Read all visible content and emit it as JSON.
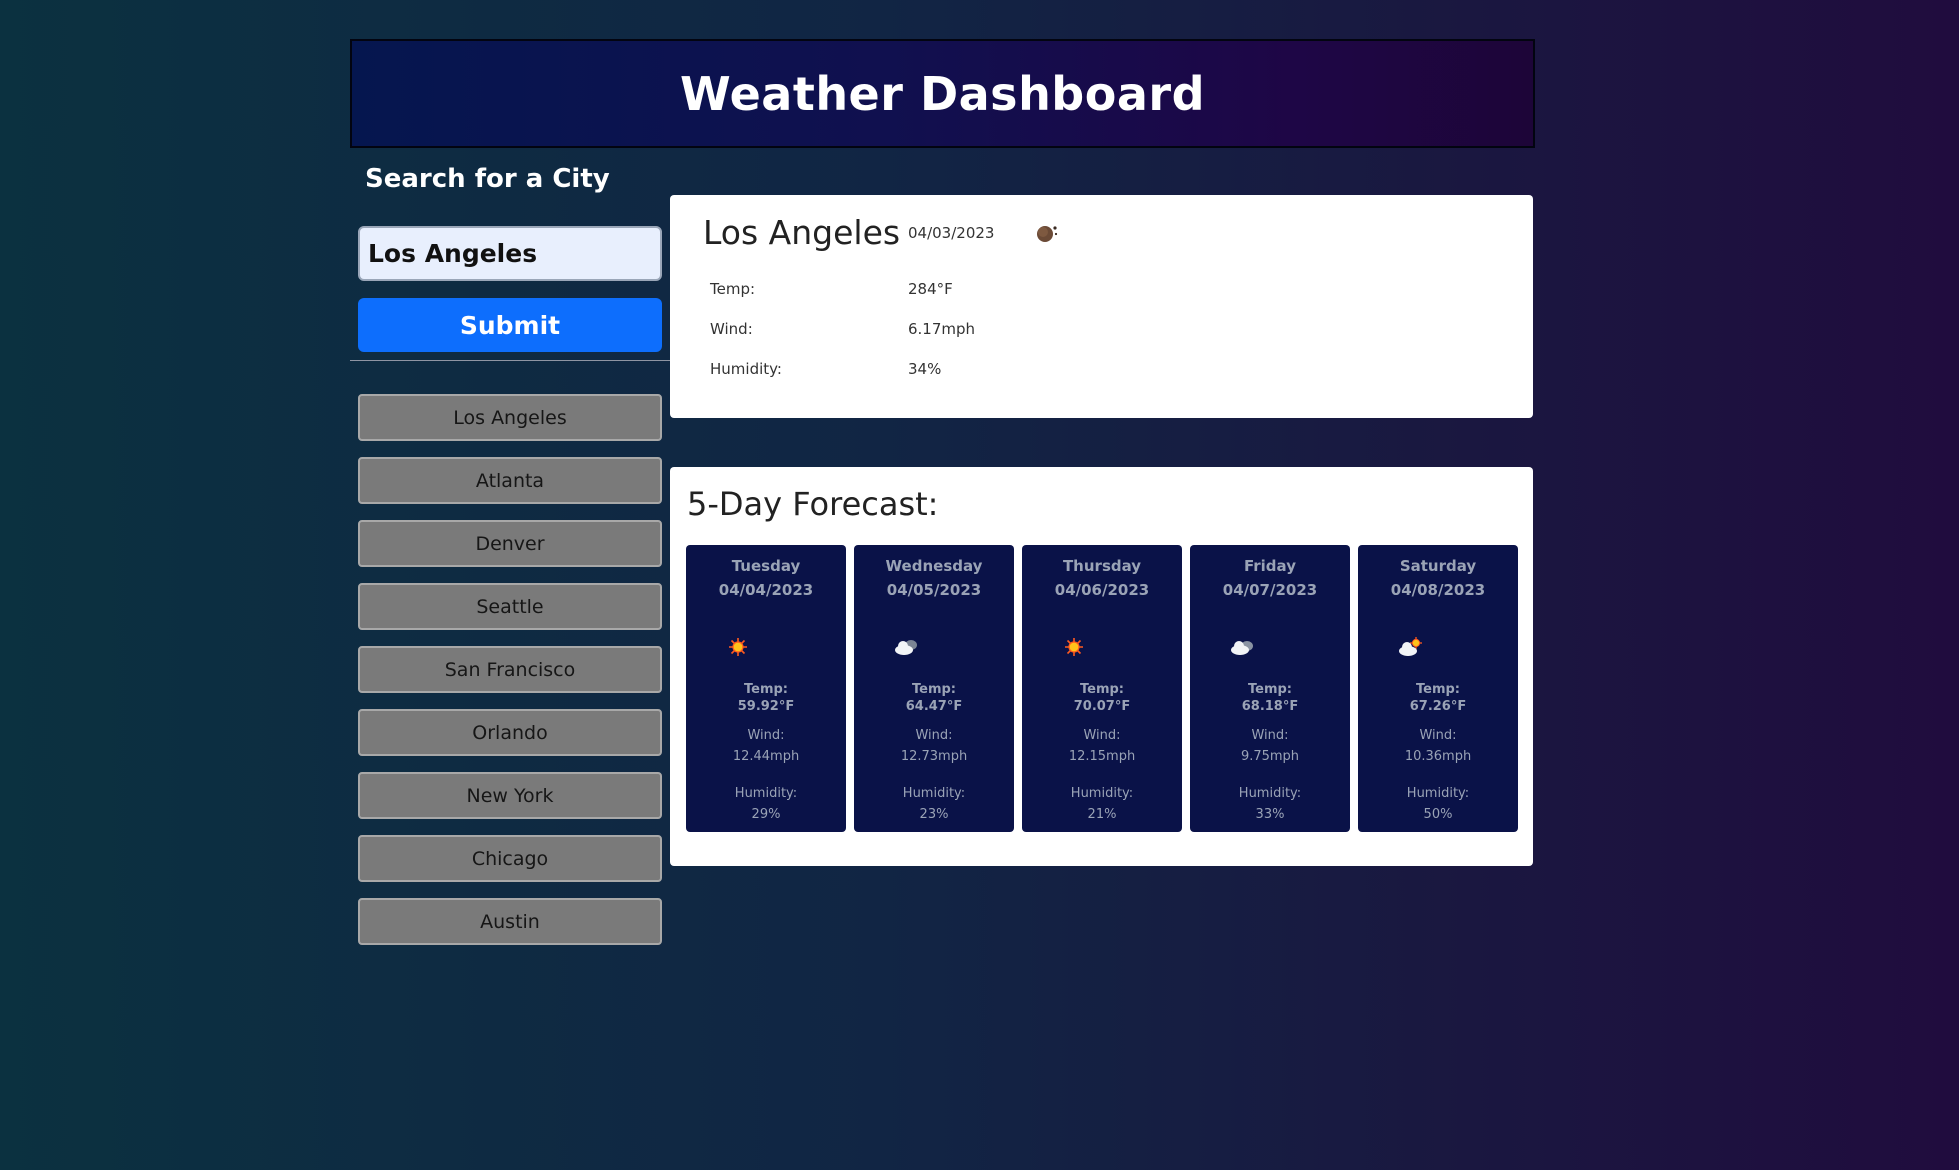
{
  "header": {
    "title": "Weather Dashboard"
  },
  "search": {
    "heading": "Search for a City",
    "input_value": "Los Angeles",
    "submit_label": "Submit"
  },
  "history": [
    "Los Angeles",
    "Atlanta",
    "Denver",
    "Seattle",
    "San Francisco",
    "Orlando",
    "New York",
    "Chicago",
    "Austin"
  ],
  "current": {
    "city": "Los Angeles",
    "date": "04/03/2023",
    "icon": "moon-icon",
    "temp_label": "Temp:",
    "temp": "284°F",
    "wind_label": "Wind:",
    "wind": "6.17mph",
    "humidity_label": "Humidity:",
    "humidity": "34%"
  },
  "forecast": {
    "title": "5-Day Forecast:",
    "days": [
      {
        "day": "Tuesday",
        "date": "04/04/2023",
        "icon": "sun-icon",
        "temp_label": "Temp:",
        "temp": "59.92°F",
        "wind_label": "Wind:",
        "wind": "12.44mph",
        "humidity_label": "Humidity:",
        "humidity": "29%"
      },
      {
        "day": "Wednesday",
        "date": "04/05/2023",
        "icon": "cloud-icon",
        "temp_label": "Temp:",
        "temp": "64.47°F",
        "wind_label": "Wind:",
        "wind": "12.73mph",
        "humidity_label": "Humidity:",
        "humidity": "23%"
      },
      {
        "day": "Thursday",
        "date": "04/06/2023",
        "icon": "sun-icon",
        "temp_label": "Temp:",
        "temp": "70.07°F",
        "wind_label": "Wind:",
        "wind": "12.15mph",
        "humidity_label": "Humidity:",
        "humidity": "21%"
      },
      {
        "day": "Friday",
        "date": "04/07/2023",
        "icon": "cloud-icon",
        "temp_label": "Temp:",
        "temp": "68.18°F",
        "wind_label": "Wind:",
        "wind": "9.75mph",
        "humidity_label": "Humidity:",
        "humidity": "33%"
      },
      {
        "day": "Saturday",
        "date": "04/08/2023",
        "icon": "partly-cloudy-icon",
        "temp_label": "Temp:",
        "temp": "67.26°F",
        "wind_label": "Wind:",
        "wind": "10.36mph",
        "humidity_label": "Humidity:",
        "humidity": "50%"
      }
    ]
  },
  "colors": {
    "submit": "#0d6efd",
    "history_button": "#7a7a7a",
    "forecast_card": "#0a1248"
  }
}
